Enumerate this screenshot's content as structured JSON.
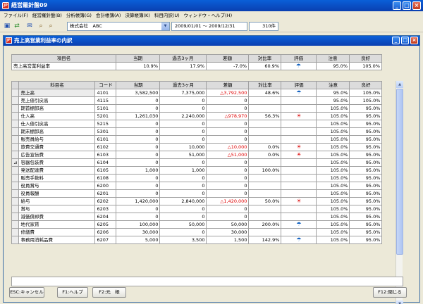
{
  "app": {
    "title": "経営羅針盤09",
    "icon": "JP"
  },
  "menu": [
    "ファイル(F)",
    "経営羅針盤(B)",
    "分析帳簿(G)",
    "会計帳簿(A)",
    "決算帳簿(K)",
    "科目内訳(U)",
    "ウィンドウ・ヘルプ(H)"
  ],
  "toolbar": {
    "company": "株式会社　ABC",
    "period": "2009/01/01 〜 2009/12/31",
    "count": "310件"
  },
  "window": {
    "title": "売上高営業利益率の内訳"
  },
  "summary": {
    "headers": [
      "項目名",
      "当期",
      "過去3ヶ月",
      "差額",
      "対比率",
      "評価",
      "注意",
      "良好"
    ],
    "row": {
      "name": "売上高営業利益率",
      "current": "10.9%",
      "past3": "17.9%",
      "diff": "-7.0%",
      "ratio": "60.9%",
      "eval": "umbrella-icon",
      "caution": "95.0%",
      "good": "105.0%"
    }
  },
  "detail": {
    "headers": [
      "科目名",
      "コード",
      "当期",
      "過去3ヶ月",
      "差額",
      "対比率",
      "評価",
      "注意",
      "良好"
    ],
    "rows": [
      {
        "mark": "",
        "name": "売上高",
        "code": "4101",
        "cur": "3,582,500",
        "past": "7,375,000",
        "diff": "△3,792,500",
        "neg": true,
        "ratio": "48.6%",
        "eval": "umbrella",
        "caution": "95.0%",
        "good": "105.0%"
      },
      {
        "mark": "",
        "name": "売上値引戻高",
        "code": "4115",
        "cur": "0",
        "past": "0",
        "diff": "0",
        "neg": false,
        "ratio": "",
        "eval": "",
        "caution": "95.0%",
        "good": "105.0%"
      },
      {
        "mark": "",
        "name": "期首棚卸高",
        "code": "5101",
        "cur": "0",
        "past": "0",
        "diff": "0",
        "neg": false,
        "ratio": "",
        "eval": "",
        "caution": "105.0%",
        "good": "95.0%"
      },
      {
        "mark": "",
        "name": "仕入高",
        "code": "5201",
        "cur": "1,261,030",
        "past": "2,240,000",
        "diff": "△978,970",
        "neg": true,
        "ratio": "56.3%",
        "eval": "sun",
        "caution": "105.0%",
        "good": "95.0%"
      },
      {
        "mark": "",
        "name": "仕入値引戻高",
        "code": "5215",
        "cur": "0",
        "past": "0",
        "diff": "0",
        "neg": false,
        "ratio": "",
        "eval": "",
        "caution": "105.0%",
        "good": "95.0%"
      },
      {
        "mark": "",
        "name": "期末棚卸高",
        "code": "5301",
        "cur": "0",
        "past": "0",
        "diff": "0",
        "neg": false,
        "ratio": "",
        "eval": "",
        "caution": "105.0%",
        "good": "95.0%"
      },
      {
        "mark": "",
        "name": "販売員給与",
        "code": "6101",
        "cur": "0",
        "past": "0",
        "diff": "0",
        "neg": false,
        "ratio": "",
        "eval": "",
        "caution": "105.0%",
        "good": "95.0%"
      },
      {
        "mark": "",
        "name": "旅費交通費",
        "code": "6102",
        "cur": "0",
        "past": "10,000",
        "diff": "△10,000",
        "neg": true,
        "ratio": "0.0%",
        "eval": "sun",
        "caution": "105.0%",
        "good": "95.0%"
      },
      {
        "mark": "",
        "name": "広告宣伝費",
        "code": "6103",
        "cur": "0",
        "past": "51,000",
        "diff": "△51,000",
        "neg": true,
        "ratio": "0.0%",
        "eval": "sun",
        "caution": "105.0%",
        "good": "95.0%"
      },
      {
        "mark": "⊿",
        "name": "容器包装費",
        "code": "6104",
        "cur": "0",
        "past": "0",
        "diff": "0",
        "neg": false,
        "ratio": "",
        "eval": "",
        "caution": "105.0%",
        "good": "95.0%"
      },
      {
        "mark": "",
        "name": "発送配達費",
        "code": "6105",
        "cur": "1,000",
        "past": "1,000",
        "diff": "0",
        "neg": false,
        "ratio": "100.0%",
        "eval": "",
        "caution": "105.0%",
        "good": "95.0%"
      },
      {
        "mark": "",
        "name": "販売手数料",
        "code": "6108",
        "cur": "0",
        "past": "0",
        "diff": "0",
        "neg": false,
        "ratio": "",
        "eval": "",
        "caution": "105.0%",
        "good": "95.0%"
      },
      {
        "mark": "",
        "name": "役員賞与",
        "code": "6200",
        "cur": "0",
        "past": "0",
        "diff": "0",
        "neg": false,
        "ratio": "",
        "eval": "",
        "caution": "105.0%",
        "good": "95.0%"
      },
      {
        "mark": "",
        "name": "役員報酬",
        "code": "6201",
        "cur": "0",
        "past": "0",
        "diff": "0",
        "neg": false,
        "ratio": "",
        "eval": "",
        "caution": "105.0%",
        "good": "95.0%"
      },
      {
        "mark": "",
        "name": "給与",
        "code": "6202",
        "cur": "1,420,000",
        "past": "2,840,000",
        "diff": "△1,420,000",
        "neg": true,
        "ratio": "50.0%",
        "eval": "sun",
        "caution": "105.0%",
        "good": "95.0%"
      },
      {
        "mark": "",
        "name": "賞与",
        "code": "6203",
        "cur": "0",
        "past": "0",
        "diff": "0",
        "neg": false,
        "ratio": "",
        "eval": "",
        "caution": "105.0%",
        "good": "95.0%"
      },
      {
        "mark": "",
        "name": "減価償却費",
        "code": "6204",
        "cur": "0",
        "past": "0",
        "diff": "0",
        "neg": false,
        "ratio": "",
        "eval": "",
        "caution": "105.0%",
        "good": "95.0%"
      },
      {
        "mark": "",
        "name": "地代家賃",
        "code": "6205",
        "cur": "100,000",
        "past": "50,000",
        "diff": "50,000",
        "neg": false,
        "ratio": "200.0%",
        "eval": "umbrella",
        "caution": "105.0%",
        "good": "95.0%"
      },
      {
        "mark": "",
        "name": "修繕費",
        "code": "6206",
        "cur": "30,000",
        "past": "0",
        "diff": "30,000",
        "neg": false,
        "ratio": "",
        "eval": "",
        "caution": "105.0%",
        "good": "95.0%"
      },
      {
        "mark": "",
        "name": "事務用消耗品費",
        "code": "6207",
        "cur": "5,000",
        "past": "3,500",
        "diff": "1,500",
        "neg": false,
        "ratio": "142.9%",
        "eval": "umbrella",
        "caution": "105.0%",
        "good": "95.0%"
      }
    ]
  },
  "icons": {
    "sun": "☀",
    "umbrella": "☂"
  },
  "buttons": {
    "esc": "ESC:キャンセル",
    "f1": "F1:ヘルプ",
    "f2": "F2:元　帳",
    "f12": "F12:閉じる"
  }
}
